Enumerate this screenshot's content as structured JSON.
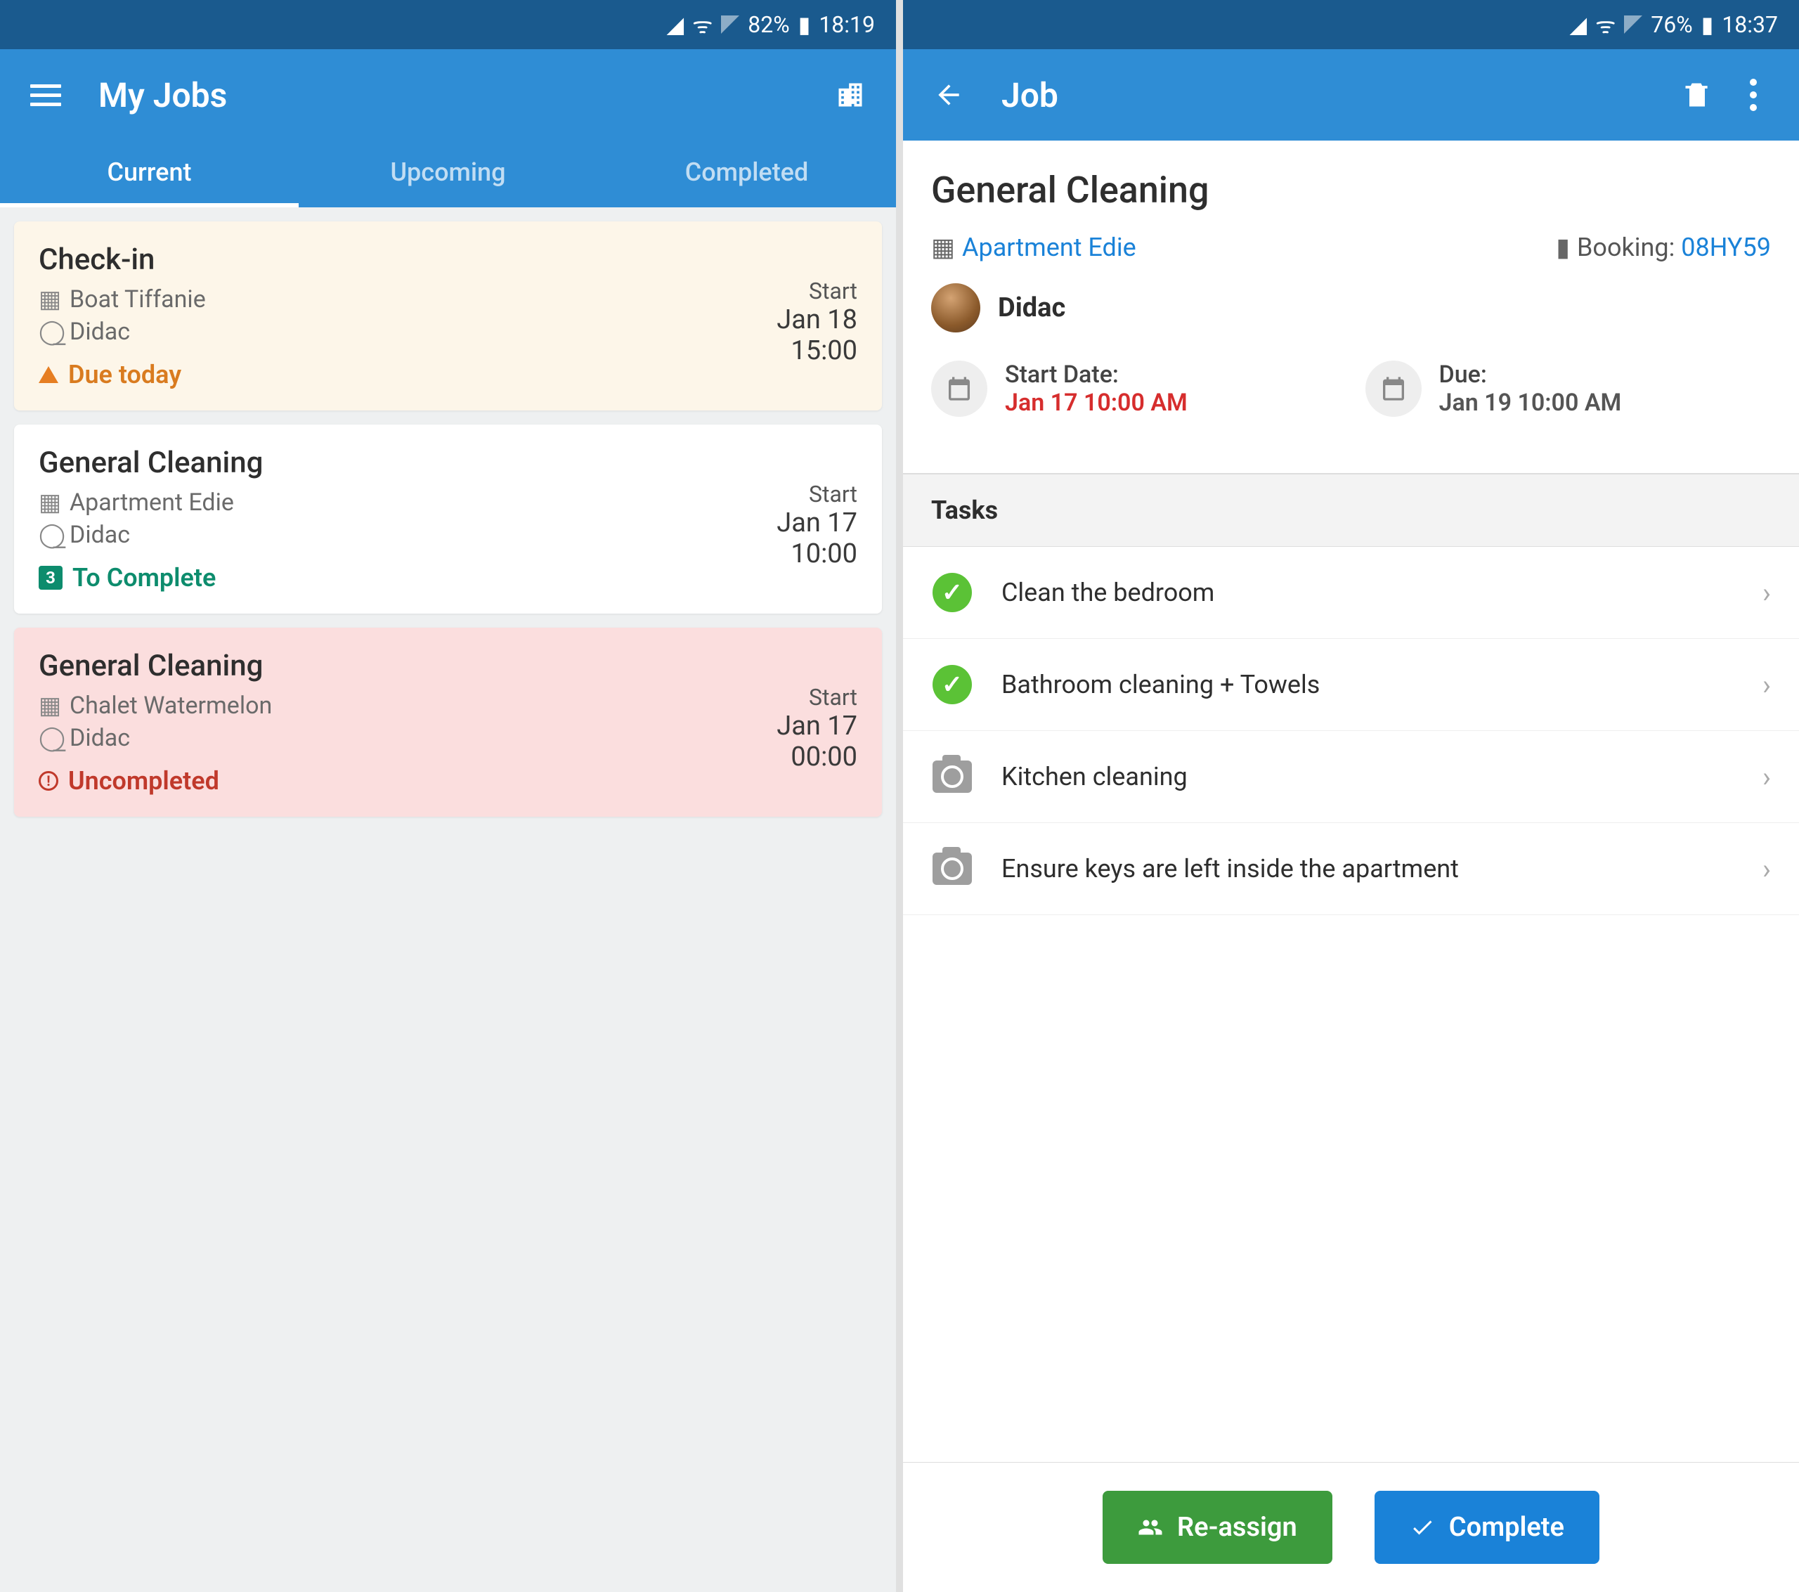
{
  "left": {
    "status": {
      "battery": "82%",
      "time": "18:19"
    },
    "appbar": {
      "title": "My Jobs"
    },
    "tabs": [
      "Current",
      "Upcoming",
      "Completed"
    ],
    "activeTab": 0,
    "startLabel": "Start",
    "jobs": [
      {
        "title": "Check-in",
        "location": "Boat Tiffanie",
        "assignee": "Didac",
        "status": "Due today",
        "statusType": "warn",
        "date": "Jan 18",
        "time": "15:00",
        "cardType": "warn"
      },
      {
        "title": "General Cleaning",
        "location": "Apartment Edie",
        "assignee": "Didac",
        "status": "To Complete",
        "statusType": "todo",
        "count": "3",
        "date": "Jan 17",
        "time": "10:00",
        "cardType": "normal"
      },
      {
        "title": "General Cleaning",
        "location": "Chalet Watermelon",
        "assignee": "Didac",
        "status": "Uncompleted",
        "statusType": "err",
        "date": "Jan 17",
        "time": "00:00",
        "cardType": "error"
      }
    ]
  },
  "right": {
    "status": {
      "battery": "76%",
      "time": "18:37"
    },
    "appbar": {
      "title": "Job"
    },
    "detail": {
      "title": "General Cleaning",
      "apartment": "Apartment Edie",
      "bookingLabel": "Booking:",
      "bookingId": "08HY59",
      "assignee": "Didac",
      "startLabel": "Start Date:",
      "startValue": "Jan 17 10:00 AM",
      "dueLabel": "Due:",
      "dueValue": "Jan 19 10:00 AM"
    },
    "tasksHeader": "Tasks",
    "tasks": [
      {
        "name": "Clean the bedroom",
        "done": true
      },
      {
        "name": "Bathroom cleaning + Towels",
        "done": true
      },
      {
        "name": "Kitchen cleaning",
        "done": false
      },
      {
        "name": "Ensure keys are left inside the apartment",
        "done": false
      }
    ],
    "buttons": {
      "reassign": "Re-assign",
      "complete": "Complete"
    }
  }
}
